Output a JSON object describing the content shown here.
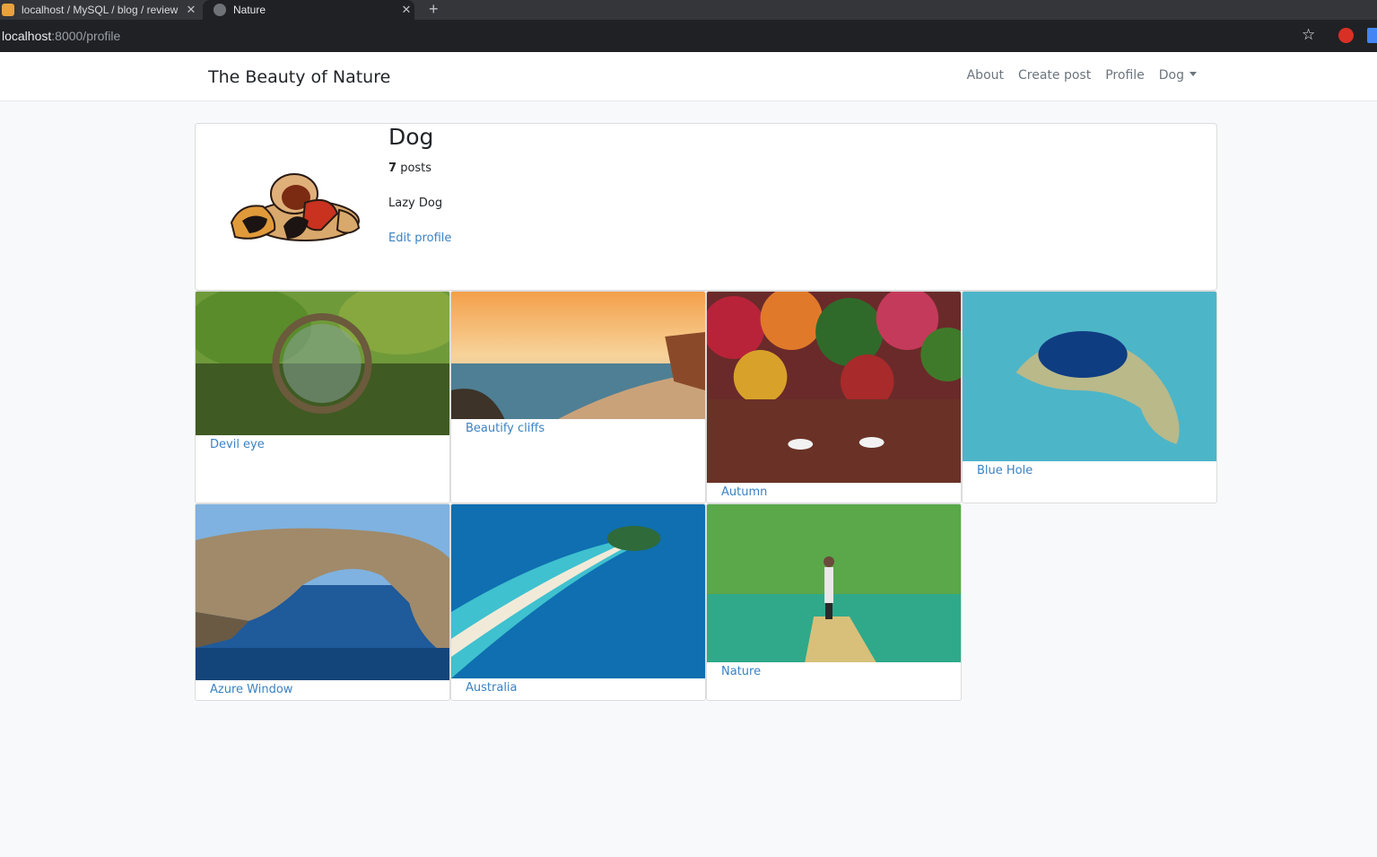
{
  "browser": {
    "tabs": [
      {
        "title": "localhost / MySQL / blog / review",
        "close": "✕"
      },
      {
        "title": "Nature",
        "close": "✕"
      }
    ],
    "new_tab": "+",
    "url_host": "localhost",
    "url_path": ":8000/profile",
    "bookmark_icon": "☆"
  },
  "navbar": {
    "brand": "The Beauty of Nature",
    "links": [
      "About",
      "Create post",
      "Profile"
    ],
    "user_menu": "Dog"
  },
  "profile": {
    "username": "Dog",
    "post_count": "7",
    "post_label": "posts",
    "bio": "Lazy Dog",
    "edit_link": "Edit profile"
  },
  "posts": [
    {
      "title": "Devil eye"
    },
    {
      "title": "Beautify cliffs"
    },
    {
      "title": "Autumn"
    },
    {
      "title": "Blue Hole"
    },
    {
      "title": "Azure Window"
    },
    {
      "title": "Australia"
    },
    {
      "title": "Nature"
    }
  ]
}
